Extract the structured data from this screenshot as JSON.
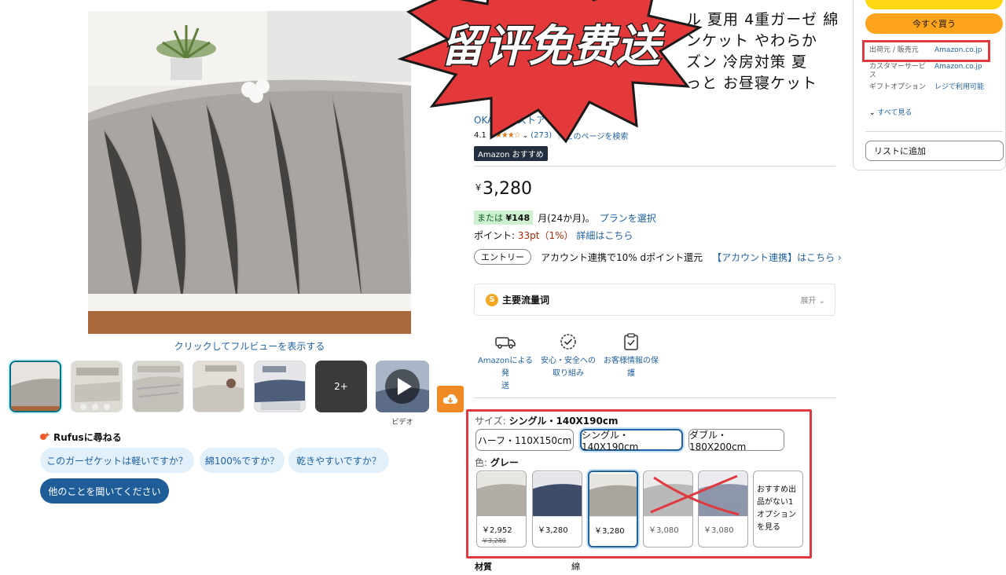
{
  "gallery": {
    "fullview_label": "クリックしてフルビューを表示する",
    "more_count": "2+",
    "video_label": "ビデオ"
  },
  "rufus": {
    "heading": "Rufusに尋ねる",
    "questions": [
      "このガーゼケットは軽いですか？",
      "綿100%ですか？",
      "乾きやすいですか？"
    ],
    "ask_label": "他のことを聞いてください"
  },
  "promo": {
    "banner_text": "留评免费送"
  },
  "product": {
    "title_lines": [
      "ル 夏用 4重ガーゼ 綿",
      "ンケット やわらか",
      "ズン 冷房対策 夏",
      "っと お昼寝ケット"
    ],
    "store_link": "OKAZOのストアを表示",
    "rating_value": "4.1",
    "rating_stars": 4.1,
    "rating_count": "(273)",
    "page_search": "このページを検索",
    "badge": "Amazon おすすめ",
    "price_symbol": "￥",
    "price": "3,280",
    "installment_prefix": "または",
    "installment_amount": "¥148",
    "installment_suffix": "月(24か月)。",
    "installment_link": "プランを選択",
    "points_label": "ポイント: ",
    "points_value": "33pt（1%）",
    "points_link": "詳細はこちら",
    "entry_pill": "エントリー",
    "entry_text": "アカウント連携で10% dポイント還元",
    "entry_link": "【アカウント連携】はこちら ›",
    "flow_title": "主要流量词",
    "flow_expand": "展开 ⌄",
    "features": [
      [
        "Amazonによる発",
        "送"
      ],
      [
        "安心・安全への",
        "取り組み"
      ],
      [
        "お客様情報の保",
        "護"
      ]
    ],
    "size_label": "サイズ: ",
    "size_selected": "シングル・140X190cm",
    "sizes": [
      "ハーフ・110X150cm",
      "シングル・140X190cm",
      "ダブル・180X200cm"
    ],
    "color_label": "色: ",
    "color_selected": "グレー",
    "swatches": [
      {
        "price": "￥2,952",
        "old_price": "￥3,280"
      },
      {
        "price": "￥3,280",
        "old_price": ""
      },
      {
        "price": "￥3,280",
        "old_price": ""
      },
      {
        "price": "￥3,080",
        "old_price": ""
      },
      {
        "price": "￥3,080",
        "old_price": ""
      }
    ],
    "swatch_more": [
      "おすすめ出",
      "品がない1",
      "オプション",
      "を見る"
    ],
    "material_label": "材質",
    "material_value": "綿"
  },
  "buybox": {
    "buy_now": "今すぐ買う",
    "rows": [
      {
        "k": "出荷元 / 販売元",
        "v": "Amazon.co.jp"
      },
      {
        "k": "カスタマーサービス",
        "v": "Amazon.co.jp"
      },
      {
        "k": "ギフトオプション",
        "v": "レジで利用可能"
      }
    ],
    "see_all": "すべて見る",
    "wishlist": "リストに追加"
  },
  "colors": {
    "accent_red": "#e0393e",
    "link_blue": "#2162a1",
    "buy_orange": "#ffa41c",
    "cart_yellow": "#ffd814",
    "star_orange": "#de7921"
  }
}
